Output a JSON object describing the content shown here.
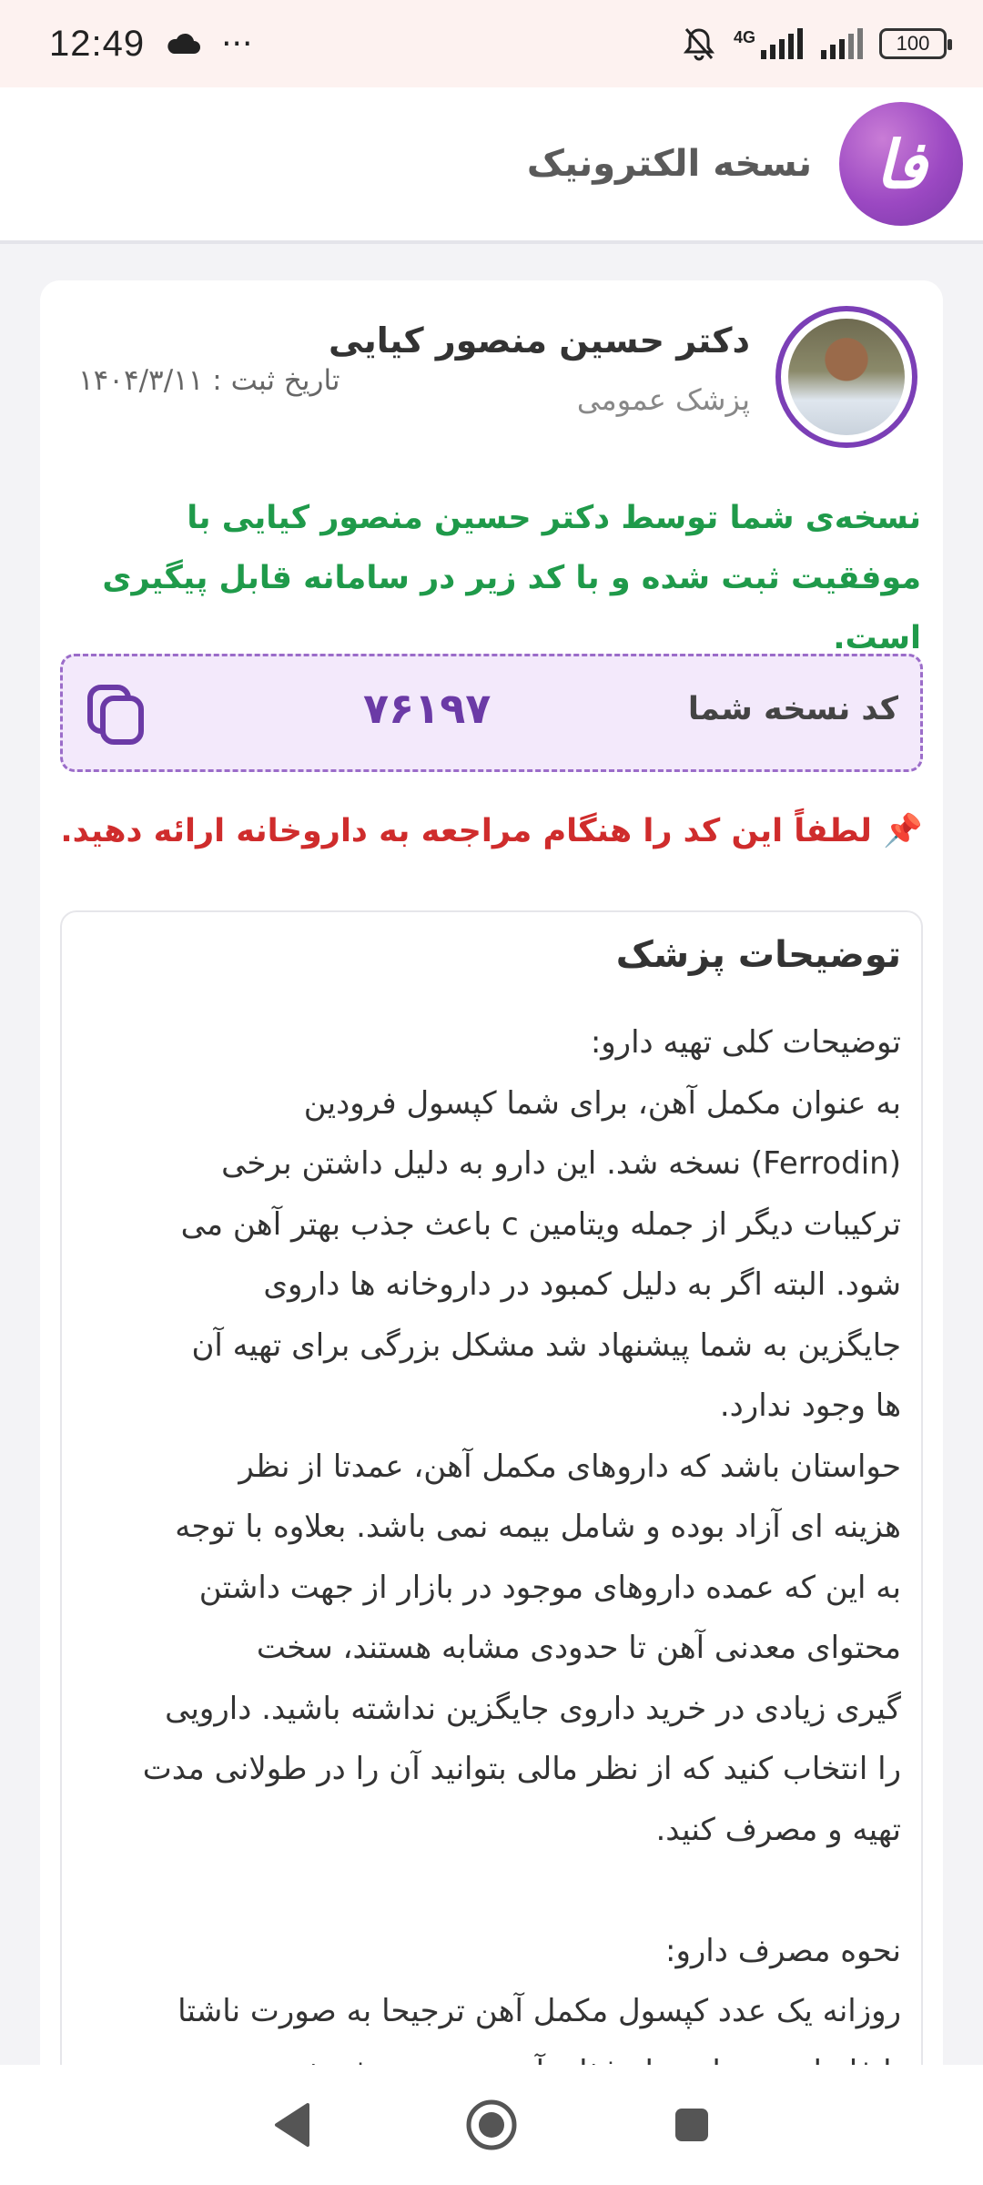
{
  "status_bar": {
    "time": "12:49",
    "more_dots": "···",
    "network_label": "4G",
    "battery": "100"
  },
  "header": {
    "title": "نسخه الکترونیک",
    "logo_text": "فا"
  },
  "doctor": {
    "name": "دکتر حسین منصور کیایی",
    "specialty": "پزشک عمومی",
    "date_label": "تاریخ ثبت : ۱۴۰۴/۳/۱۱"
  },
  "success_message": "نسخه‌ی شما توسط دکتر حسین منصور کیایی با موفقیت ثبت شده و با کد زیر در سامانه قابل پیگیری است.",
  "prescription": {
    "code_label": "کد نسخه شما",
    "code_value": "۷۶۱۹۷"
  },
  "notice": "📌 لطفاً این کد را هنگام مراجعه به داروخانه ارائه دهید.",
  "doctor_notes": {
    "title": "توضیحات پزشک",
    "body": "توضیحات کلی تهیه دارو:\nبه عنوان مکمل آهن، برای شما کپسول فرودین\n(Ferrodin) نسخه شد. این دارو به دلیل داشتن برخی\nترکیبات دیگر از جمله ویتامین c باعث جذب بهتر آهن می\nشود. البته اگر به دلیل کمبود در داروخانه ها داروی\nجایگزین به شما پیشنهاد شد مشکل بزرگی برای تهیه آن\nها وجود ندارد.\nحواستان باشد که داروهای مکمل آهن، عمدتا از نظر\nهزینه ای آزاد بوده و شامل بیمه نمی باشد. بعلاوه با توجه\nبه این که عمده داروهای موجود در بازار از جهت داشتن\nمحتوای معدنی آهن تا حدودی مشابه هستند، سخت\nگیری زیادی در خرید داروی جایگزین نداشته باشید. دارویی\nرا انتخاب کنید که از نظر مالی بتوانید آن را در طولانی مدت\nتهیه و مصرف کنید.\n\nنحوه مصرف دارو:\nروزانه یک عدد کپسول مکمل آهن ترجیحا به صورت ناشتا\nیا فاصله دو ساعت از غذا و آب میوه مصرف شود."
  },
  "colors": {
    "accent": "#7b3fb6",
    "success": "#1f9a4a",
    "warning": "#cf2c2c",
    "code_bg": "#f3e9fb"
  },
  "icons": {
    "copy": "copy-icon",
    "back": "back-icon",
    "home": "home-icon",
    "recents": "recents-icon"
  }
}
